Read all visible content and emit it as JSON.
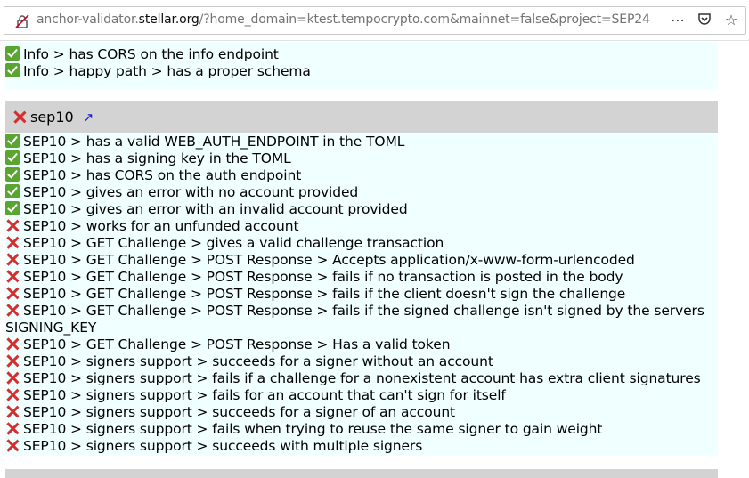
{
  "browser": {
    "url_host_prefix": "anchor-validator.",
    "url_host": "stellar.org",
    "url_rest": "/?home_domain=ktest.tempocrypto.com&mainnet=false&project=SEP24",
    "more_icon": "⋯",
    "pocket_icon": "pocket-icon",
    "bookmark_icon": "☆"
  },
  "info_section": {
    "results": [
      {
        "status": "pass",
        "text": "Info > has CORS on the info endpoint"
      },
      {
        "status": "pass",
        "text": "Info > happy path > has a proper schema"
      }
    ]
  },
  "sep10_section": {
    "title": "sep10",
    "status": "fail",
    "link_icon": "↗",
    "results": [
      {
        "status": "pass",
        "text": "SEP10 > has a valid WEB_AUTH_ENDPOINT in the TOML"
      },
      {
        "status": "pass",
        "text": "SEP10 > has a signing key in the TOML"
      },
      {
        "status": "pass",
        "text": "SEP10 > has CORS on the auth endpoint"
      },
      {
        "status": "pass",
        "text": "SEP10 > gives an error with no account provided"
      },
      {
        "status": "pass",
        "text": "SEP10 > gives an error with an invalid account provided"
      },
      {
        "status": "fail",
        "text": "SEP10 > works for an unfunded account"
      },
      {
        "status": "fail",
        "text": "SEP10 > GET Challenge > gives a valid challenge transaction"
      },
      {
        "status": "fail",
        "text": "SEP10 > GET Challenge > POST Response > Accepts application/x-www-form-urlencoded"
      },
      {
        "status": "fail",
        "text": "SEP10 > GET Challenge > POST Response > fails if no transaction is posted in the body"
      },
      {
        "status": "fail",
        "text": "SEP10 > GET Challenge > POST Response > fails if the client doesn't sign the challenge"
      },
      {
        "status": "fail",
        "text": "SEP10 > GET Challenge > POST Response > fails if the signed challenge isn't signed by the servers SIGNING_KEY"
      },
      {
        "status": "fail",
        "text": "SEP10 > GET Challenge > POST Response > Has a valid token"
      },
      {
        "status": "fail",
        "text": "SEP10 > signers support > succeeds for a signer without an account"
      },
      {
        "status": "fail",
        "text": "SEP10 > signers support > fails if a challenge for a nonexistent account has extra client signatures"
      },
      {
        "status": "fail",
        "text": "SEP10 > signers support > fails for an account that can't sign for itself"
      },
      {
        "status": "fail",
        "text": "SEP10 > signers support > succeeds for a signer of an account"
      },
      {
        "status": "fail",
        "text": "SEP10 > signers support > fails when trying to reuse the same signer to gain weight"
      },
      {
        "status": "fail",
        "text": "SEP10 > signers support > succeeds with multiple signers"
      }
    ]
  },
  "colors": {
    "pass": "#5aa531",
    "fail": "#d62d2d",
    "panel_bg": "#f0ffff",
    "section_bg": "#d3d3d3",
    "link": "#1a1ae6"
  }
}
